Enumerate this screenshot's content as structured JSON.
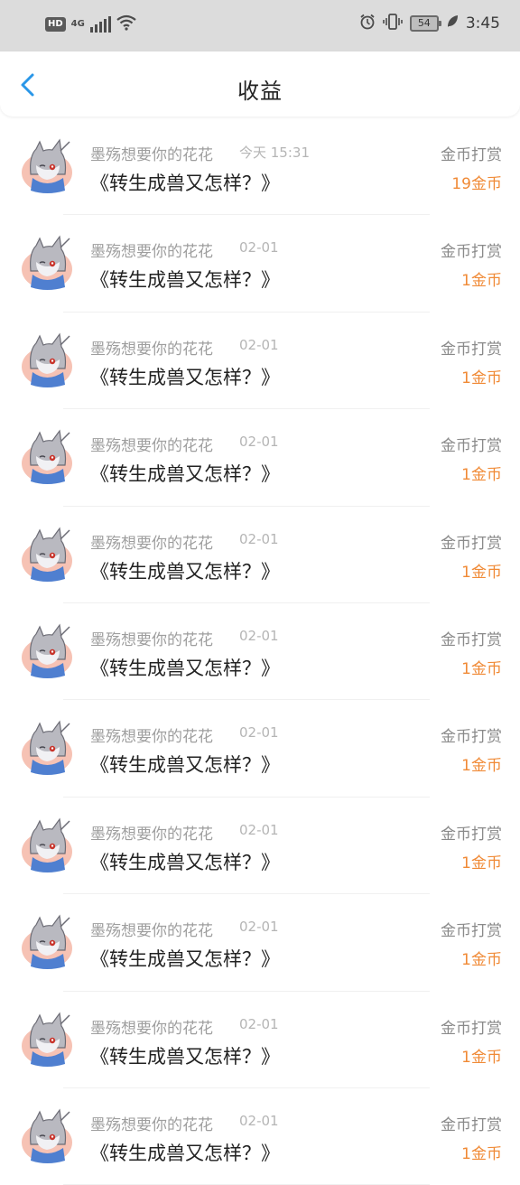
{
  "status_bar": {
    "hd": "HD",
    "network": "4G",
    "battery": "54",
    "time": "3:45"
  },
  "header": {
    "title": "收益"
  },
  "records": [
    {
      "name": "墨殇想要你的花花",
      "date": "今天 15:31",
      "book": "《转生成兽又怎样？》",
      "type": "金币打赏",
      "amount": "19金币"
    },
    {
      "name": "墨殇想要你的花花",
      "date": "02-01",
      "book": "《转生成兽又怎样？》",
      "type": "金币打赏",
      "amount": "1金币"
    },
    {
      "name": "墨殇想要你的花花",
      "date": "02-01",
      "book": "《转生成兽又怎样？》",
      "type": "金币打赏",
      "amount": "1金币"
    },
    {
      "name": "墨殇想要你的花花",
      "date": "02-01",
      "book": "《转生成兽又怎样？》",
      "type": "金币打赏",
      "amount": "1金币"
    },
    {
      "name": "墨殇想要你的花花",
      "date": "02-01",
      "book": "《转生成兽又怎样？》",
      "type": "金币打赏",
      "amount": "1金币"
    },
    {
      "name": "墨殇想要你的花花",
      "date": "02-01",
      "book": "《转生成兽又怎样？》",
      "type": "金币打赏",
      "amount": "1金币"
    },
    {
      "name": "墨殇想要你的花花",
      "date": "02-01",
      "book": "《转生成兽又怎样？》",
      "type": "金币打赏",
      "amount": "1金币"
    },
    {
      "name": "墨殇想要你的花花",
      "date": "02-01",
      "book": "《转生成兽又怎样？》",
      "type": "金币打赏",
      "amount": "1金币"
    },
    {
      "name": "墨殇想要你的花花",
      "date": "02-01",
      "book": "《转生成兽又怎样？》",
      "type": "金币打赏",
      "amount": "1金币"
    },
    {
      "name": "墨殇想要你的花花",
      "date": "02-01",
      "book": "《转生成兽又怎样？》",
      "type": "金币打赏",
      "amount": "1金币"
    },
    {
      "name": "墨殇想要你的花花",
      "date": "02-01",
      "book": "《转生成兽又怎样？》",
      "type": "金币打赏",
      "amount": "1金币"
    }
  ],
  "colors": {
    "accent": "#2a97e8",
    "amount": "#f08a36",
    "status_bar_bg": "#dcdcdc"
  },
  "icons": {
    "back": "chevron-left-icon",
    "avatar": "wolf-avatar-icon"
  }
}
